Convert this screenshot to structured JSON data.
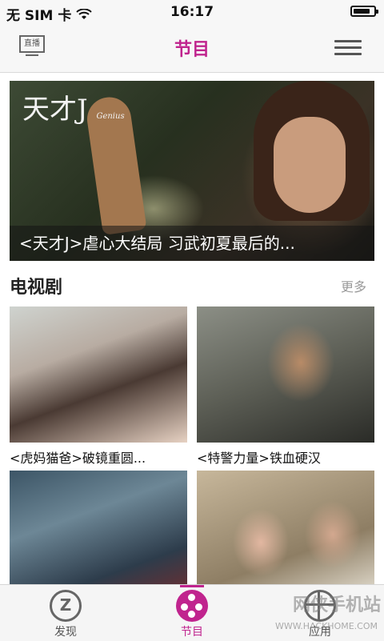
{
  "status_bar": {
    "carrier": "无 SIM 卡",
    "time": "16:17",
    "battery_level": 0.85
  },
  "nav": {
    "live_label": "直播",
    "title": "节目"
  },
  "hero": {
    "logo": "天才J",
    "logo_sub": "Genius",
    "caption": "<天才J>虐心大结局 习武初夏最后的..."
  },
  "section": {
    "title": "电视剧",
    "more": "更多",
    "items": [
      {
        "label": "<虎妈猫爸>破镜重圆..."
      },
      {
        "label": "<特警力量>铁血硬汉"
      },
      {
        "label": ""
      },
      {
        "label": ""
      }
    ]
  },
  "tabs": [
    {
      "label": "发现",
      "icon": "discover-icon"
    },
    {
      "label": "节目",
      "icon": "programs-icon",
      "active": true
    },
    {
      "label": "应用",
      "icon": "app-grid-icon"
    }
  ],
  "watermark": {
    "text": "网侠手机站",
    "url": "WWW.HACKHOME.COM"
  },
  "colors": {
    "accent": "#c0248e",
    "navbar": "#f7f7f7"
  }
}
